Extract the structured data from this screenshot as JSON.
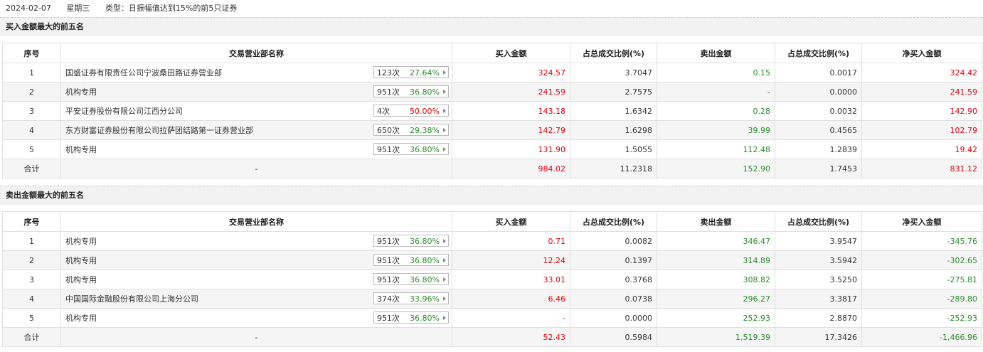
{
  "header": {
    "date": "2024-02-07",
    "weekday": "星期三",
    "type": "类型：日振幅值达到15%的前5只证券"
  },
  "columns": [
    "序号",
    "交易营业部名称",
    "买入金额",
    "占总成交比例(%)",
    "卖出金额",
    "占总成交比例(%)",
    "净买入金额"
  ],
  "buy_section": {
    "title": "买入金额最大的前五名",
    "rows": [
      {
        "no": "1",
        "name": "国盛证券有限责任公司宁波桑田路证券营业部",
        "count": "123次",
        "pct": "27.64%",
        "buy": "324.57",
        "buy_ratio": "3.7047",
        "sell": "0.15",
        "sell_ratio": "0.0017",
        "net": "324.42"
      },
      {
        "no": "2",
        "name": "机构专用",
        "count": "951次",
        "pct": "36.80%",
        "buy": "241.59",
        "buy_ratio": "2.7575",
        "sell": "-",
        "sell_ratio": "0.0000",
        "net": "241.59"
      },
      {
        "no": "3",
        "name": "平安证券股份有限公司江西分公司",
        "count": "4次",
        "pct": "50.00%",
        "buy": "143.18",
        "buy_ratio": "1.6342",
        "sell": "0.28",
        "sell_ratio": "0.0032",
        "net": "142.90"
      },
      {
        "no": "4",
        "name": "东方财富证券股份有限公司拉萨团结路第一证券营业部",
        "count": "650次",
        "pct": "29.38%",
        "buy": "142.79",
        "buy_ratio": "1.6298",
        "sell": "39.99",
        "sell_ratio": "0.4565",
        "net": "102.79"
      },
      {
        "no": "5",
        "name": "机构专用",
        "count": "951次",
        "pct": "36.80%",
        "buy": "131.90",
        "buy_ratio": "1.5055",
        "sell": "112.48",
        "sell_ratio": "1.2839",
        "net": "19.42"
      }
    ],
    "total": {
      "label": "合计",
      "name": "-",
      "buy": "984.02",
      "buy_ratio": "11.2318",
      "sell": "152.90",
      "sell_ratio": "1.7453",
      "net": "831.12"
    }
  },
  "sell_section": {
    "title": "卖出金额最大的前五名",
    "rows": [
      {
        "no": "1",
        "name": "机构专用",
        "count": "951次",
        "pct": "36.80%",
        "buy": "0.71",
        "buy_ratio": "0.0082",
        "sell": "346.47",
        "sell_ratio": "3.9547",
        "net": "-345.76"
      },
      {
        "no": "2",
        "name": "机构专用",
        "count": "951次",
        "pct": "36.80%",
        "buy": "12.24",
        "buy_ratio": "0.1397",
        "sell": "314.89",
        "sell_ratio": "3.5942",
        "net": "-302.65"
      },
      {
        "no": "3",
        "name": "机构专用",
        "count": "951次",
        "pct": "36.80%",
        "buy": "33.01",
        "buy_ratio": "0.3768",
        "sell": "308.82",
        "sell_ratio": "3.5250",
        "net": "-275.81"
      },
      {
        "no": "4",
        "name": "中国国际金融股份有限公司上海分公司",
        "count": "374次",
        "pct": "33.96%",
        "buy": "6.46",
        "buy_ratio": "0.0738",
        "sell": "296.27",
        "sell_ratio": "3.3817",
        "net": "-289.80"
      },
      {
        "no": "5",
        "name": "机构专用",
        "count": "951次",
        "pct": "36.80%",
        "buy": "-",
        "buy_ratio": "0.0000",
        "sell": "252.93",
        "sell_ratio": "2.8870",
        "net": "-252.93"
      }
    ],
    "total": {
      "label": "合计",
      "name": "-",
      "buy": "52.43",
      "buy_ratio": "0.5984",
      "sell": "1,519.39",
      "sell_ratio": "17.3426",
      "net": "-1,466.96"
    }
  },
  "colors": {
    "buy": "#e3000f",
    "sell": "#2a8a2a",
    "pct_red": "#dd0000",
    "pct_green": "#2a8a2a"
  }
}
